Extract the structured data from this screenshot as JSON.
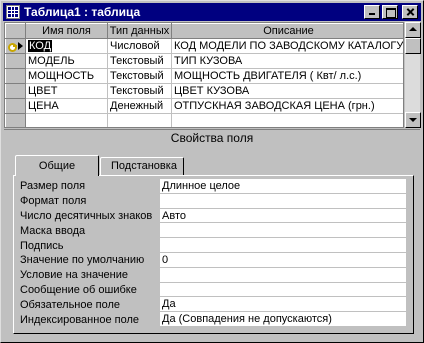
{
  "window": {
    "title": "Таблица1 : таблица",
    "accent": "#000080"
  },
  "columns": [
    "Имя поля",
    "Тип данных",
    "Описание"
  ],
  "fields": [
    {
      "name": "КОД",
      "type": "Числовой",
      "description": "КОД МОДЕЛИ ПО ЗАВОДСКОМУ КАТАЛОГУ",
      "primary_key": true,
      "current": true
    },
    {
      "name": "МОДЕЛЬ",
      "type": "Текстовый",
      "description": "ТИП КУЗОВА"
    },
    {
      "name": "МОЩНОСТЬ",
      "type": "Текстовый",
      "description": "МОЩНОСТЬ ДВИГАТЕЛЯ ( Квт/ л.с.)"
    },
    {
      "name": "ЦВЕТ",
      "type": "Текстовый",
      "description": "ЦВЕТ КУЗОВА"
    },
    {
      "name": "ЦЕНА",
      "type": "Денежный",
      "description": "ОТПУСКНАЯ ЗАВОДСКАЯ ЦЕНА  (грн.)"
    }
  ],
  "properties_header": "Свойства поля",
  "tabs": [
    "Общие",
    "Подстановка"
  ],
  "properties": [
    {
      "label": "Размер поля",
      "value": "Длинное целое"
    },
    {
      "label": "Формат поля",
      "value": ""
    },
    {
      "label": "Число десятичных знаков",
      "value": "Авто"
    },
    {
      "label": "Маска ввода",
      "value": ""
    },
    {
      "label": "Подпись",
      "value": ""
    },
    {
      "label": "Значение по умолчанию",
      "value": "0"
    },
    {
      "label": "Условие на значение",
      "value": ""
    },
    {
      "label": "Сообщение об ошибке",
      "value": ""
    },
    {
      "label": "Обязательное поле",
      "value": "Да"
    },
    {
      "label": "Индексированное поле",
      "value": "Да (Совпадения не допускаются)"
    }
  ]
}
